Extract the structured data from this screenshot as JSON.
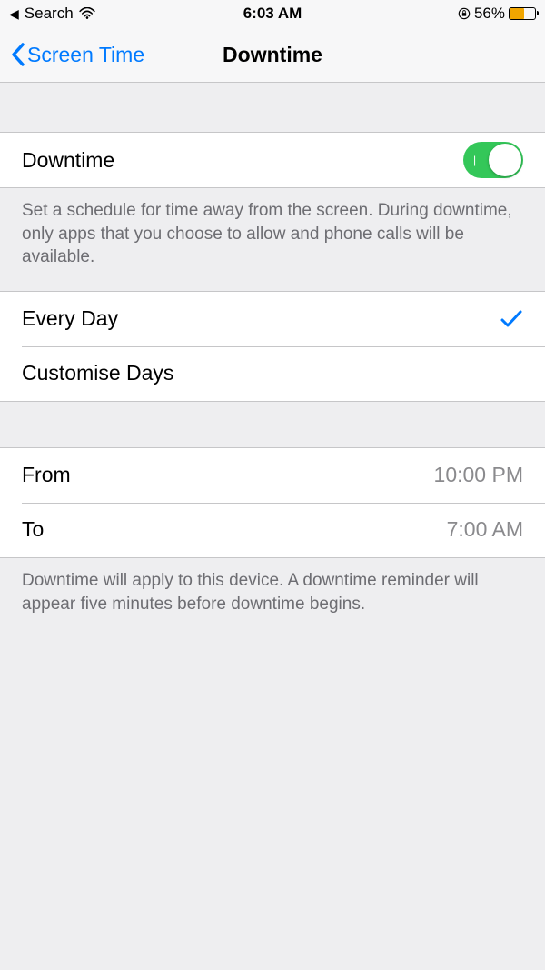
{
  "statusBar": {
    "backApp": "Search",
    "time": "6:03 AM",
    "batteryPercent": "56%"
  },
  "nav": {
    "backLabel": "Screen Time",
    "title": "Downtime"
  },
  "downtimeToggle": {
    "label": "Downtime",
    "footer": "Set a schedule for time away from the screen. During downtime, only apps that you choose to allow and phone calls will be available."
  },
  "scheduleMode": {
    "everyDay": "Every Day",
    "customiseDays": "Customise Days"
  },
  "timeRange": {
    "fromLabel": "From",
    "fromValue": "10:00 PM",
    "toLabel": "To",
    "toValue": "7:00 AM",
    "footer": "Downtime will apply to this device. A downtime reminder will appear five minutes before downtime begins."
  }
}
